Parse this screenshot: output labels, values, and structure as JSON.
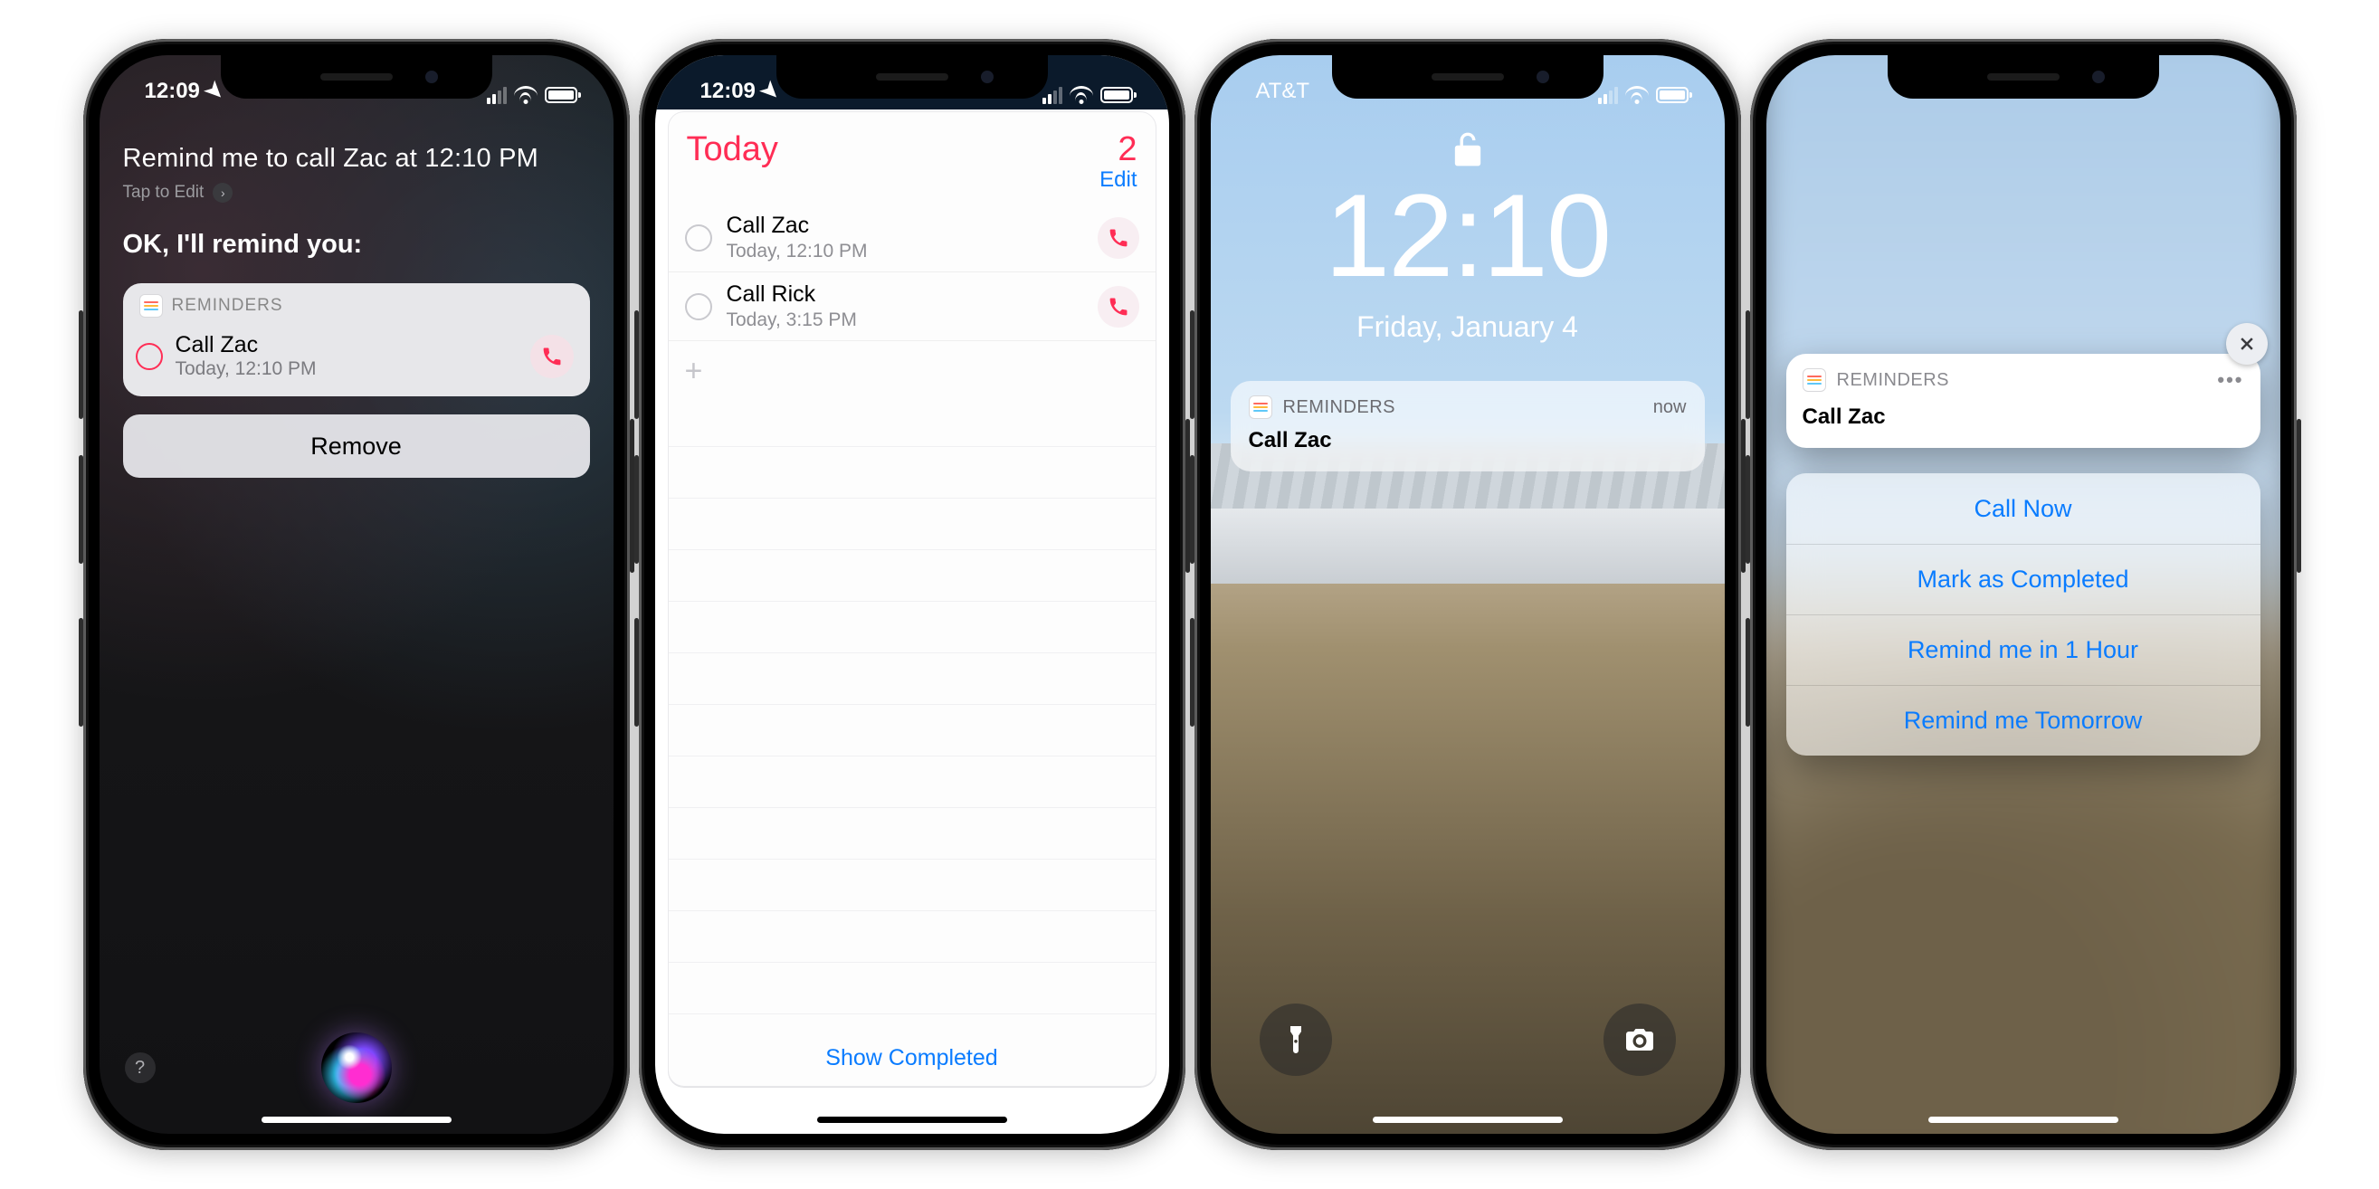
{
  "phone1": {
    "status": {
      "time": "12:09"
    },
    "query": "Remind me to call Zac at 12:10 PM",
    "tap_to_edit": "Tap to Edit",
    "response": "OK, I'll remind you:",
    "app_name": "REMINDERS",
    "item": {
      "title": "Call Zac",
      "subtitle": "Today, 12:10 PM"
    },
    "remove": "Remove",
    "help": "?"
  },
  "phone2": {
    "status": {
      "time": "12:09"
    },
    "header": {
      "title": "Today",
      "count": "2",
      "edit": "Edit"
    },
    "items": [
      {
        "title": "Call Zac",
        "subtitle": "Today, 12:10 PM"
      },
      {
        "title": "Call Rick",
        "subtitle": "Today, 3:15 PM"
      }
    ],
    "add_glyph": "+",
    "show_completed": "Show Completed"
  },
  "phone3": {
    "carrier": "AT&T",
    "time": "12:10",
    "date": "Friday, January 4",
    "notification": {
      "app_name": "REMINDERS",
      "when": "now",
      "message": "Call Zac"
    }
  },
  "phone4": {
    "card": {
      "app_name": "REMINDERS",
      "more": "•••",
      "title": "Call Zac"
    },
    "actions": [
      "Call Now",
      "Mark as Completed",
      "Remind me in 1 Hour",
      "Remind me Tomorrow"
    ]
  }
}
